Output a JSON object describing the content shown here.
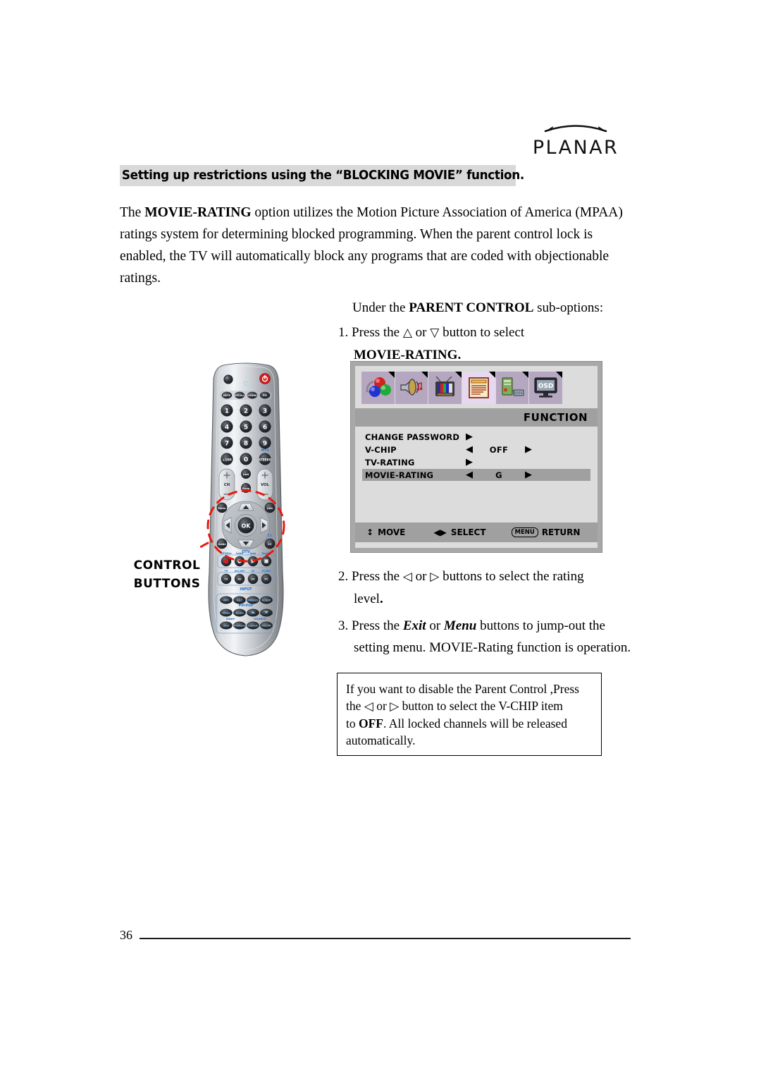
{
  "page": {
    "number": "36",
    "brand": "PLANAR"
  },
  "heading": {
    "text": "Setting up restrictions using the “BLOCKING MOVIE” function."
  },
  "intro": {
    "before": "The ",
    "bold": "MOVIE-RATING",
    "after": " option utilizes the Motion Picture Association of America (MPAA) ratings system for determining blocked programming. When the parent control lock is enabled, the TV will automatically block any programs that are coded with objectionable ratings."
  },
  "steps": {
    "under_before": "Under the ",
    "under_bold": "PARENT CONTROL",
    "under_after": " sub-options:",
    "step1_num": "1.",
    "step1_a": "Press the",
    "step1_up": "△",
    "step1_or": "or",
    "step1_down": "▽",
    "step1_b": "button to select",
    "step1_target": "MOVIE-RATING",
    "step1_period": ".",
    "step2_num": "2.",
    "step2_a": "Press the",
    "step2_left": "◁",
    "step2_or": "or",
    "step2_right": "▷",
    "step2_b": "buttons to select the rating",
    "step2_sub": "level",
    "step2_period": ".",
    "step3_num": "3.",
    "step3_a": "Press the",
    "step3_exit": "Exit",
    "step3_or": "or",
    "step3_menu": "Menu",
    "step3_b": "buttons to jump-out the",
    "step3_sub": "setting menu. MOVIE-Rating function is operation."
  },
  "note": {
    "l1_a": "If you want to disable the Parent Control ,Press",
    "l2_a": "the",
    "l2_left": "◁",
    "l2_or": "or",
    "l2_right": "▷",
    "l2_b": "button to select the V-CHIP item",
    "l3_a": "to ",
    "l3_bold": "OFF",
    "l3_b": ". All locked channels will be released",
    "l4": "automatically."
  },
  "osd": {
    "title": "FUNCTION",
    "icons": [
      {
        "name": "picture-color-balls-icon",
        "active": false
      },
      {
        "name": "audio-speaker-icon",
        "active": false
      },
      {
        "name": "tv-channel-icon",
        "active": false
      },
      {
        "name": "function-document-icon",
        "active": true
      },
      {
        "name": "pc-setup-icon",
        "active": false
      },
      {
        "name": "osd-monitor-icon",
        "active": false
      }
    ],
    "rows": [
      {
        "label": "CHANGE PASSWORD",
        "left_arrow": "",
        "value": "",
        "right_arrow": "▶",
        "arrow_pos": "label",
        "selected": false
      },
      {
        "label": "V-CHIP",
        "left_arrow": "◀",
        "value": "OFF",
        "right_arrow": "▶",
        "arrow_pos": "both",
        "selected": false
      },
      {
        "label": "TV-RATING",
        "left_arrow": "",
        "value": "",
        "right_arrow": "▶",
        "arrow_pos": "label",
        "selected": false
      },
      {
        "label": "MOVIE-RATING",
        "left_arrow": "◀",
        "value": "G",
        "right_arrow": "▶",
        "arrow_pos": "both",
        "selected": true
      }
    ],
    "footer": {
      "move_glyph": "↕",
      "move_label": "MOVE",
      "select_glyph": "◀▶",
      "select_label": "SELECT",
      "menu_key": "MENU",
      "return_label": "RETURN"
    }
  },
  "callout": {
    "line1": "CONTROL",
    "line2": "BUTTONS"
  },
  "remote": {
    "name": "tv-remote-control",
    "power_button": "power-icon",
    "numbers": [
      "1",
      "2",
      "3",
      "4",
      "5",
      "6",
      "7",
      "8",
      "9",
      "0"
    ],
    "plus100": "+100",
    "mts_label": "MTS",
    "ch_label": "CH",
    "vol_label": "VOL",
    "ok_label": "OK",
    "dtv_label": "DTV",
    "cc_label": "CC",
    "input_label": "INPUT",
    "pippop_label": "PIP/POP",
    "swap_label": "SWAP",
    "source_label": "SOURCE",
    "bottom_buttons": [
      "APC",
      "ASC",
      "FREEZE",
      "SLEEP",
      "Video",
      "Audio",
      "Size",
      "Position",
      "Layout",
      "On/Off"
    ]
  },
  "colors": {
    "banner_gray": "#d9d9d9",
    "osd_frame": "#a8a8a8",
    "osd_body": "#dcdcdc",
    "osd_bar": "#a0a0a0",
    "icon_tile": "#b6a7c0",
    "icon_tile_active": "#e6d8ee",
    "callout_red": "#e8180c",
    "power_red": "#d42020",
    "remote_blue": "#1f6fd0"
  }
}
